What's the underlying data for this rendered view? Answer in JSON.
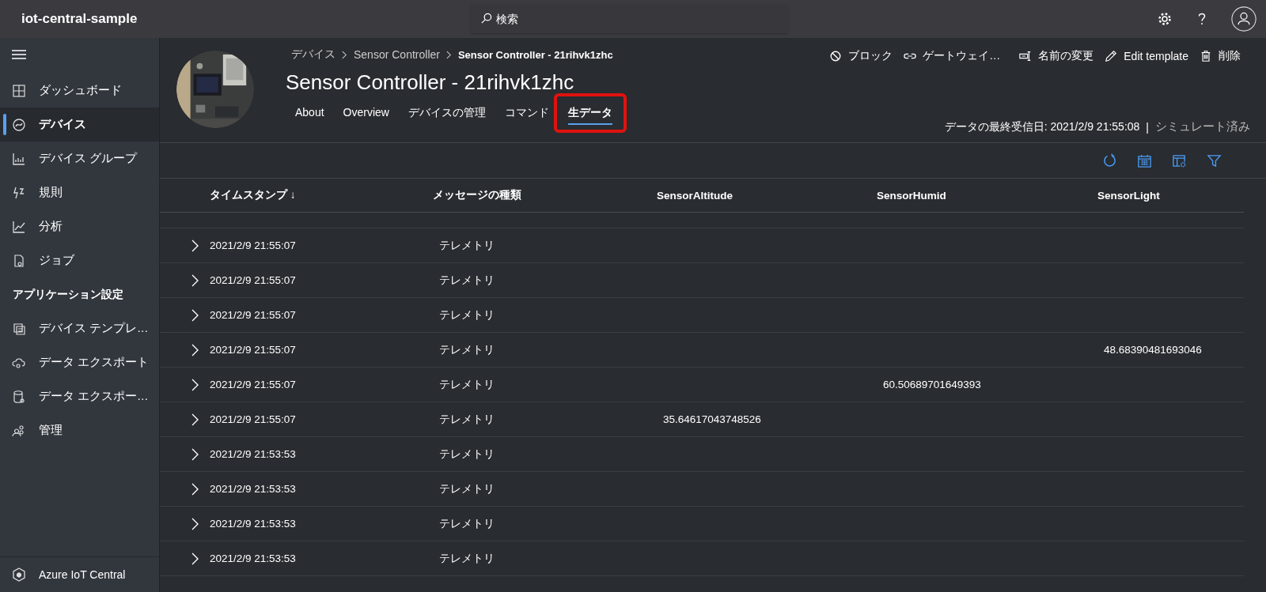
{
  "app": {
    "title": "iot-central-sample"
  },
  "search": {
    "placeholder": "検索"
  },
  "sidebar": {
    "items": [
      {
        "kind": "nav",
        "label": "ダッシュボード",
        "selected": false
      },
      {
        "kind": "nav",
        "label": "デバイス",
        "selected": true
      },
      {
        "kind": "nav",
        "label": "デバイス グループ",
        "selected": false
      },
      {
        "kind": "nav",
        "label": "規則",
        "selected": false
      },
      {
        "kind": "nav",
        "label": "分析",
        "selected": false
      },
      {
        "kind": "nav",
        "label": "ジョブ",
        "selected": false
      },
      {
        "kind": "heading",
        "label": "アプリケーション設定"
      },
      {
        "kind": "nav",
        "label": "デバイス テンプレ…",
        "selected": false
      },
      {
        "kind": "nav",
        "label": "データ エクスポート",
        "selected": false
      },
      {
        "kind": "nav",
        "label": "データ エクスポー…",
        "selected": false
      },
      {
        "kind": "nav",
        "label": "管理",
        "selected": false
      }
    ],
    "footer": "Azure IoT Central"
  },
  "breadcrumb": [
    "デバイス",
    "Sensor Controller",
    "Sensor Controller - 21rihvk1zhc"
  ],
  "device": {
    "title": "Sensor Controller - 21rihvk1zhc"
  },
  "actions": [
    "ブロック",
    "ゲートウェイ…",
    "名前の変更",
    "Edit template",
    "削除"
  ],
  "tabs": [
    {
      "label": "About",
      "selected": false,
      "highlighted": false
    },
    {
      "label": "Overview",
      "selected": false,
      "highlighted": false
    },
    {
      "label": "デバイスの管理",
      "selected": false,
      "highlighted": false
    },
    {
      "label": "コマンド",
      "selected": false,
      "highlighted": false
    },
    {
      "label": "生データ",
      "selected": true,
      "highlighted": true
    }
  ],
  "status": {
    "last_received": "データの最終受信日: 2021/2/9 21:55:08",
    "separator": "|",
    "mode": "シミュレート済み"
  },
  "table": {
    "columns": [
      {
        "label": "タイムスタンプ",
        "sort_indicator": "↓"
      },
      {
        "label": "メッセージの種類"
      },
      {
        "label": "SensorAltitude"
      },
      {
        "label": "SensorHumid"
      },
      {
        "label": "SensorLight"
      }
    ],
    "rows": [
      {
        "timestamp": "2021/2/9 21:55:07",
        "type": "テレメトリ"
      },
      {
        "timestamp": "2021/2/9 21:55:07",
        "type": "テレメトリ"
      },
      {
        "timestamp": "2021/2/9 21:55:07",
        "type": "テレメトリ"
      },
      {
        "timestamp": "2021/2/9 21:55:07",
        "type": "テレメトリ",
        "sensor_light": "48.68390481693046"
      },
      {
        "timestamp": "2021/2/9 21:55:07",
        "type": "テレメトリ",
        "sensor_humid": "60.50689701649393"
      },
      {
        "timestamp": "2021/2/9 21:55:07",
        "type": "テレメトリ",
        "sensor_altitude": "35.64617043748526"
      },
      {
        "timestamp": "2021/2/9 21:53:53",
        "type": "テレメトリ"
      },
      {
        "timestamp": "2021/2/9 21:53:53",
        "type": "テレメトリ"
      },
      {
        "timestamp": "2021/2/9 21:53:53",
        "type": "テレメトリ"
      },
      {
        "timestamp": "2021/2/9 21:53:53",
        "type": "テレメトリ"
      }
    ]
  }
}
